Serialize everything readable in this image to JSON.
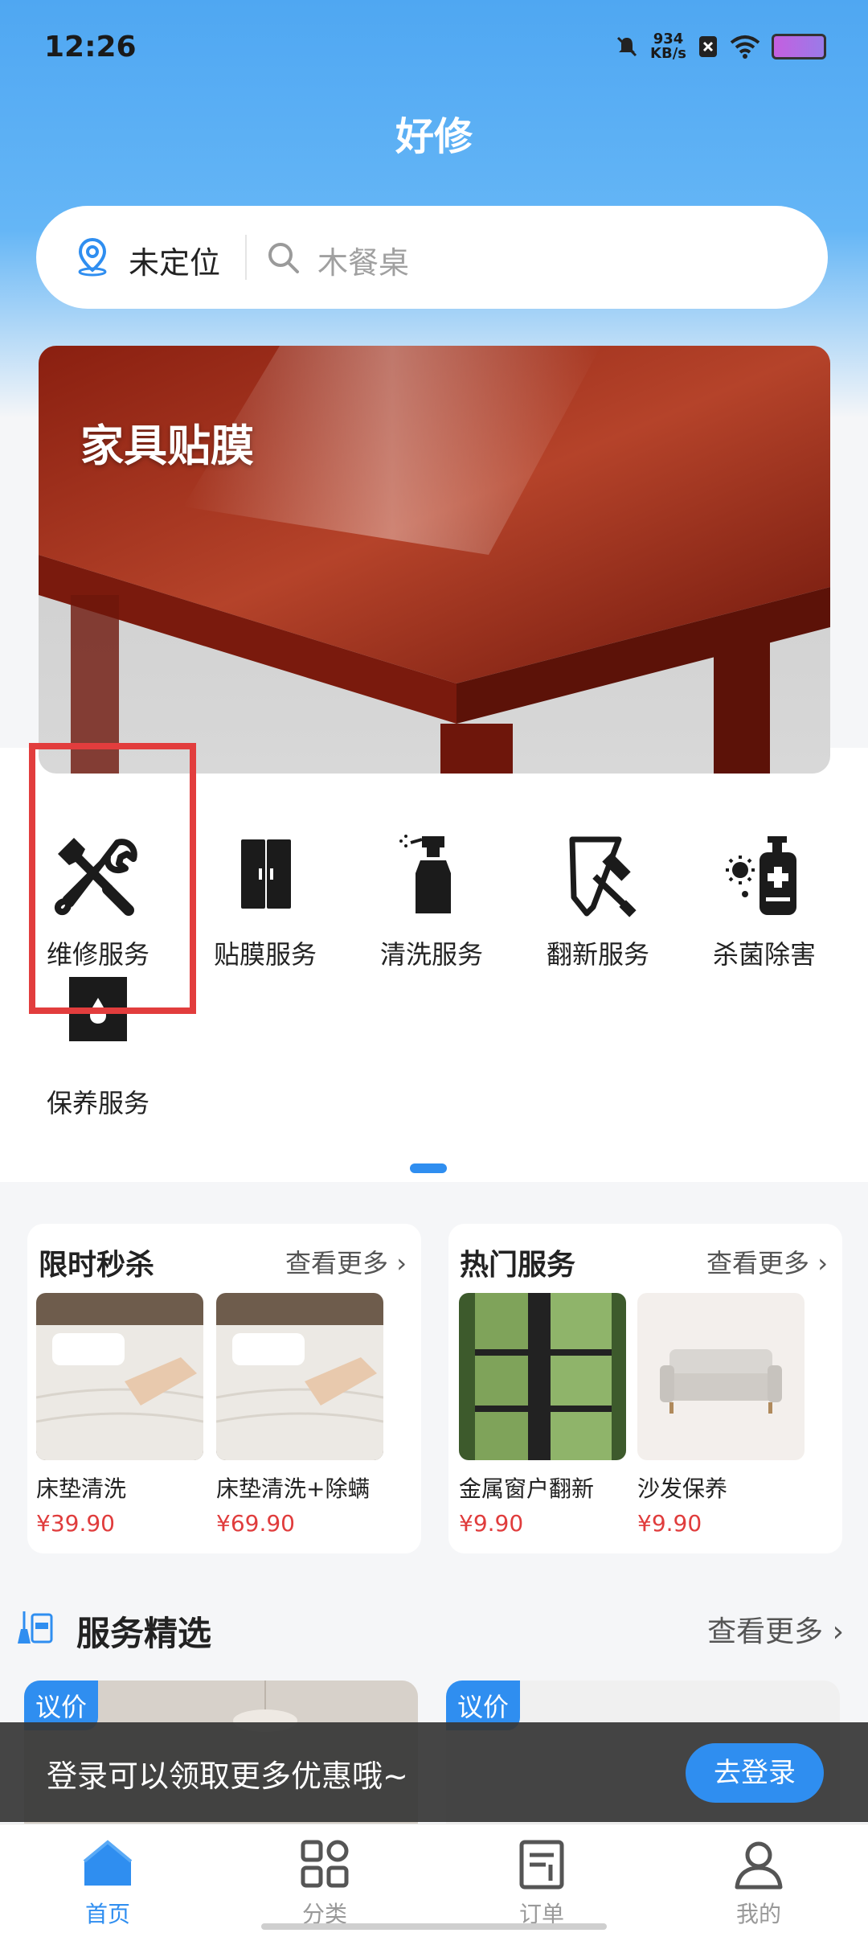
{
  "status_bar": {
    "time": "12:26",
    "net_speed_value": "934",
    "net_speed_unit": "KB/s"
  },
  "header": {
    "title": "好修"
  },
  "search": {
    "location": "未定位",
    "placeholder": "木餐桌"
  },
  "banner": {
    "label": "家具贴膜"
  },
  "services": [
    {
      "label": "维修服务",
      "icon": "wrench-screwdriver-icon"
    },
    {
      "label": "贴膜服务",
      "icon": "wardrobe-icon"
    },
    {
      "label": "清洗服务",
      "icon": "spray-bottle-icon"
    },
    {
      "label": "翻新服务",
      "icon": "paint-roller-icon"
    },
    {
      "label": "杀菌除害",
      "icon": "sanitizer-icon"
    },
    {
      "label": "保养服务",
      "icon": "oil-can-icon"
    }
  ],
  "flash_sale": {
    "title": "限时秒杀",
    "more": "查看更多",
    "items": [
      {
        "name": "床垫清洗",
        "price": "¥39.90"
      },
      {
        "name": "床垫清洗+除螨",
        "price": "¥69.90"
      }
    ]
  },
  "hot_services": {
    "title": "热门服务",
    "more": "查看更多",
    "items": [
      {
        "name": "金属窗户翻新",
        "price": "¥9.90"
      },
      {
        "name": "沙发保养",
        "price": "¥9.90"
      }
    ]
  },
  "selection": {
    "title": "服务精选",
    "more": "查看更多",
    "cards": [
      {
        "tag": "议价"
      },
      {
        "tag": "议价"
      }
    ]
  },
  "toast": {
    "text": "登录可以领取更多优惠哦~",
    "button": "去登录"
  },
  "tabbar": {
    "items": [
      {
        "label": "首页",
        "icon": "home-icon"
      },
      {
        "label": "分类",
        "icon": "grid-icon"
      },
      {
        "label": "订单",
        "icon": "order-icon"
      },
      {
        "label": "我的",
        "icon": "user-icon"
      }
    ]
  },
  "colors": {
    "accent": "#2f8ef0",
    "price": "#e03c3c",
    "highlight": "#e23d3d"
  }
}
